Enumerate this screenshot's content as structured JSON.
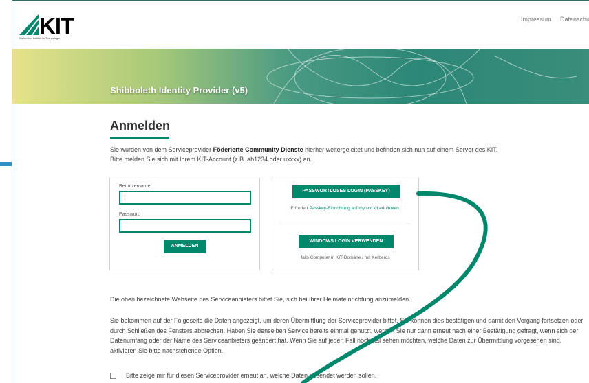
{
  "header": {
    "logo_text": "KIT",
    "logo_subtitle": "Karlsruher Institut für Technologie",
    "links": [
      "Impressum",
      "Datenschutz"
    ]
  },
  "banner": {
    "title": "Shibboleth Identity Provider (v5)"
  },
  "main": {
    "heading": "Anmelden",
    "intro_prefix": "Sie wurden von dem Serviceprovider ",
    "intro_sp": "Föderierte Community Dienste",
    "intro_suffix": " hierher weitergeleitet und befinden sich nun auf einem Server des KIT.",
    "intro_line2": "Bitte melden Sie sich mit Ihrem KIT-Account (z.B. ab1234 oder uxxxx) an."
  },
  "login": {
    "username_label": "Benutzername:",
    "username_value": "",
    "password_label": "Passwort:",
    "password_value": "",
    "submit_label": "ANMELDEN"
  },
  "alt_login": {
    "passkey_button": "PASSWORTLOSES LOGIN (PASSKEY)",
    "passkey_note_prefix": "Erfordert ",
    "passkey_note_link": "Passkey-Einrichtung auf my.scc.kit.edu/token",
    "passkey_note_suffix": ".",
    "windows_button": "WINDOWS LOGIN VERWENDEN",
    "windows_note": "falls Computer in KIT-Domäne / mit Kerberos"
  },
  "info": {
    "para1": "Die oben bezeichnete Webseite des Serviceanbieters bittet Sie, sich bei Ihrer Heimateinrichtung anzumelden.",
    "para2": "Sie bekommen auf der Folgeseite die Daten angezeigt, um deren Übermittlung der Serviceprovider bittet. Sie können dies bestätigen und damit den Vorgang fortsetzen oder durch Schließen des Fensters abbrechen. Haben Sie denselben Service bereits einmal genutzt, werden Sie nur dann erneut nach einer Bestätigung gefragt, wenn sich der Datenumfang oder der Name des Serviceanbieters geändert hat. Wenn Sie auf jeden Fall nochmal sehen möchten, welche Daten zur Übermittlung vorgesehen sind, aktivieren Sie bitte nachstehende Option.",
    "option_label": "Bitte zeige mir für diesen Serviceprovider erneut an, welche Daten gesendet werden sollen.",
    "option_checked": false
  },
  "colors": {
    "accent": "#00876c",
    "annotation": "#00876c"
  }
}
